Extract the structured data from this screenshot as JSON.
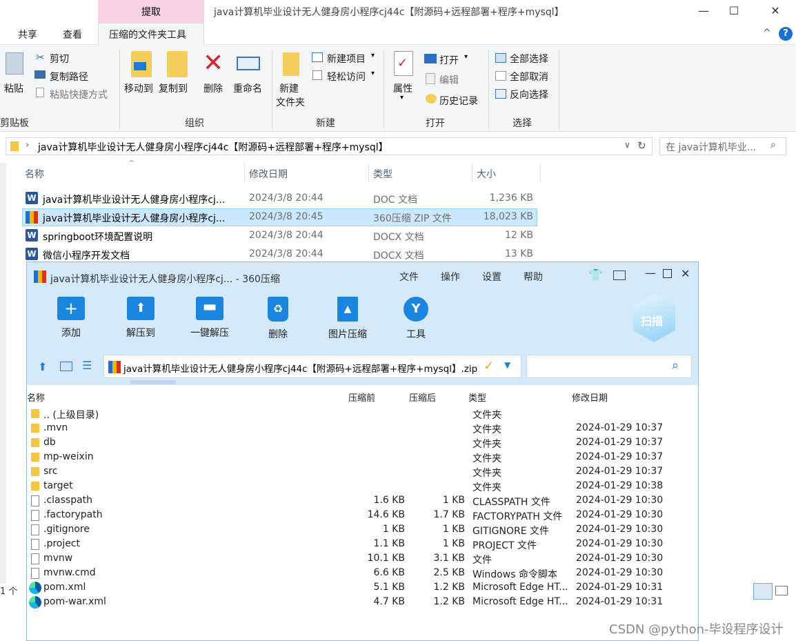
{
  "explorer": {
    "title": "java计算机毕业设计无人健身房小程序cj44c【附源码+远程部署+程序+mysql】",
    "context_tab": "提取",
    "ribbon_tabs": [
      "共享",
      "查看",
      "压缩的文件夹工具"
    ],
    "clipboard": {
      "paste": "粘贴",
      "cut": "剪切",
      "copy_path": "复制路径",
      "paste_shortcut": "粘贴快捷方式",
      "group": "剪贴板"
    },
    "organize": {
      "move_to": "移动到",
      "copy_to": "复制到",
      "delete": "删除",
      "rename": "重命名",
      "group": "组织"
    },
    "new": {
      "new_folder_1": "新建",
      "new_folder_2": "文件夹",
      "new_item": "新建项目",
      "easy_access": "轻松访问",
      "group": "新建"
    },
    "open": {
      "properties": "属性",
      "open": "打开",
      "edit": "编辑",
      "history": "历史记录",
      "group": "打开"
    },
    "select": {
      "select_all": "全部选择",
      "select_none": "全部取消",
      "invert": "反向选择",
      "group": "选择"
    },
    "address": "java计算机毕业设计无人健身房小程序cj44c【附源码+远程部署+程序+mysql】",
    "search_placeholder": "在 java计算机毕业...",
    "columns": {
      "name": "名称",
      "date": "修改日期",
      "type": "类型",
      "size": "大小"
    },
    "files": [
      {
        "name": "java计算机毕业设计无人健身房小程序cj...",
        "date": "2024/3/8 20:44",
        "type": "DOC 文档",
        "size": "1,236 KB",
        "icon": "word-icon"
      },
      {
        "name": "java计算机毕业设计无人健身房小程序cj...",
        "date": "2024/3/8 20:45",
        "type": "360压缩 ZIP 文件",
        "size": "18,023 KB",
        "icon": "zip-icon"
      },
      {
        "name": "springboot环境配置说明",
        "date": "2024/3/8 20:44",
        "type": "DOCX 文档",
        "size": "12 KB",
        "icon": "word-icon"
      },
      {
        "name": "微信小程序开发文档",
        "date": "2024/3/8 20:44",
        "type": "DOCX 文档",
        "size": "13 KB",
        "icon": "word-icon"
      }
    ],
    "status": "1 个"
  },
  "zip360": {
    "title": "java计算机毕业设计无人健身房小程序cj... - 360压缩",
    "menu": [
      "文件",
      "操作",
      "设置",
      "帮助"
    ],
    "tools": [
      "添加",
      "解压到",
      "一键解压",
      "删除",
      "图片压缩",
      "工具"
    ],
    "scan": "扫描",
    "path": "java计算机毕业设计无人健身房小程序cj44c【附源码+远程部署+程序+mysql】.zip",
    "columns": {
      "name": "名称",
      "before": "压缩前",
      "after": "压缩后",
      "type": "类型",
      "date": "修改日期"
    },
    "rows": [
      {
        "name": ".. (上级目录)",
        "before": "",
        "after": "",
        "type": "文件夹",
        "date": "",
        "icon": "folder"
      },
      {
        "name": ".mvn",
        "before": "",
        "after": "",
        "type": "文件夹",
        "date": "2024-01-29 10:37",
        "icon": "folder"
      },
      {
        "name": "db",
        "before": "",
        "after": "",
        "type": "文件夹",
        "date": "2024-01-29 10:37",
        "icon": "folder"
      },
      {
        "name": "mp-weixin",
        "before": "",
        "after": "",
        "type": "文件夹",
        "date": "2024-01-29 10:37",
        "icon": "folder"
      },
      {
        "name": "src",
        "before": "",
        "after": "",
        "type": "文件夹",
        "date": "2024-01-29 10:37",
        "icon": "folder"
      },
      {
        "name": "target",
        "before": "",
        "after": "",
        "type": "文件夹",
        "date": "2024-01-29 10:38",
        "icon": "folder"
      },
      {
        "name": ".classpath",
        "before": "1.6 KB",
        "after": "1 KB",
        "type": "CLASSPATH 文件",
        "date": "2024-01-29 10:30",
        "icon": "file"
      },
      {
        "name": ".factorypath",
        "before": "14.6 KB",
        "after": "1.7 KB",
        "type": "FACTORYPATH 文件",
        "date": "2024-01-29 10:30",
        "icon": "file"
      },
      {
        "name": ".gitignore",
        "before": "1 KB",
        "after": "1 KB",
        "type": "GITIGNORE 文件",
        "date": "2024-01-29 10:30",
        "icon": "file"
      },
      {
        "name": ".project",
        "before": "1.1 KB",
        "after": "1 KB",
        "type": "PROJECT 文件",
        "date": "2024-01-29 10:30",
        "icon": "file"
      },
      {
        "name": "mvnw",
        "before": "10.1 KB",
        "after": "3.1 KB",
        "type": "文件",
        "date": "2024-01-29 10:30",
        "icon": "file"
      },
      {
        "name": "mvnw.cmd",
        "before": "6.6 KB",
        "after": "2.5 KB",
        "type": "Windows 命令脚本",
        "date": "2024-01-29 10:30",
        "icon": "file"
      },
      {
        "name": "pom.xml",
        "before": "5.1 KB",
        "after": "1.2 KB",
        "type": "Microsoft Edge HT...",
        "date": "2024-01-29 10:31",
        "icon": "edge"
      },
      {
        "name": "pom-war.xml",
        "before": "4.7 KB",
        "after": "1.2 KB",
        "type": "Microsoft Edge HT...",
        "date": "2024-01-29 10:31",
        "icon": "edge"
      }
    ]
  },
  "watermark": "CSDN @python-毕设程序设计"
}
